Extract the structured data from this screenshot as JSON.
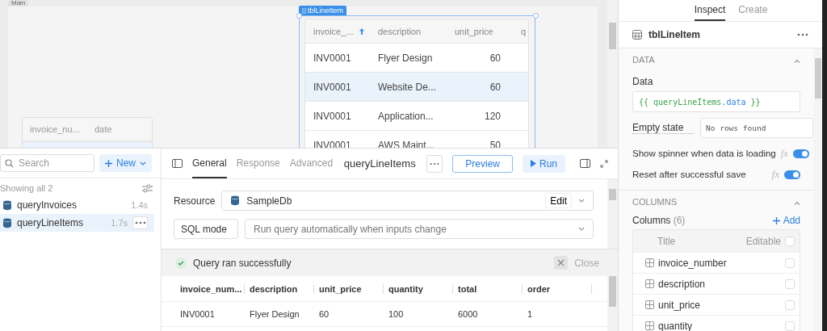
{
  "canvas": {
    "frame_label": "Main",
    "line_item_table": {
      "tag": "tblLineItem",
      "selected": true,
      "columns": [
        {
          "label": "invoice_...",
          "sorted": true
        },
        {
          "label": "description",
          "sorted": false
        },
        {
          "label": "unit_price",
          "sorted": false
        },
        {
          "label": "q",
          "sorted": false
        }
      ],
      "rows": [
        {
          "cells": [
            "INV0001",
            "Flyer Design",
            "60"
          ],
          "selected": false
        },
        {
          "cells": [
            "INV0001",
            "Website De...",
            "60"
          ],
          "selected": true
        },
        {
          "cells": [
            "INV0001",
            "Application...",
            "120"
          ],
          "selected": false
        },
        {
          "cells": [
            "INV0001",
            "AWS Maint...",
            "50"
          ],
          "selected": false
        }
      ]
    },
    "invoice_table": {
      "columns": [
        "invoice_nu...",
        "date"
      ]
    }
  },
  "queries": {
    "search": {
      "placeholder": "Search"
    },
    "new_button": "New",
    "showing": "Showing all 2",
    "items": [
      {
        "name": "queryInvoices",
        "time": "1.4s",
        "selected": false
      },
      {
        "name": "queryLineItems",
        "time": "1.7s",
        "selected": true
      }
    ]
  },
  "editor": {
    "tabs": [
      {
        "label": "General",
        "selected": true
      },
      {
        "label": "Response",
        "selected": false
      },
      {
        "label": "Advanced",
        "selected": false
      }
    ],
    "title": "queryLineItems",
    "preview": "Preview",
    "run": "Run",
    "resource": {
      "label": "Resource",
      "value": "SampleDb",
      "edit": "Edit"
    },
    "mode": "SQL mode",
    "trigger": "Run query automatically when inputs change",
    "status": {
      "message": "Query ran successfully",
      "close": "Close"
    },
    "results": {
      "columns": [
        "invoice_num...",
        "description",
        "unit_price",
        "quantity",
        "total",
        "order"
      ],
      "rows": [
        [
          "INV0001",
          "Flyer Design",
          "60",
          "100",
          "6000",
          "1"
        ]
      ]
    }
  },
  "inspector": {
    "tabs": [
      {
        "label": "Inspect",
        "selected": true
      },
      {
        "label": "Create",
        "selected": false
      }
    ],
    "component": "tblLineItem",
    "data_section": {
      "title": "DATA",
      "expanded": true,
      "data_label": "Data",
      "data_tokens": [
        {
          "text": "{{ queryLineItems",
          "kind": "template"
        },
        {
          "text": ".data",
          "kind": "property"
        },
        {
          "text": " }}",
          "kind": "template"
        }
      ],
      "empty_label": "Empty state",
      "empty_value": "No rows found",
      "toggles": [
        {
          "label": "Show spinner when data is loading",
          "fx": "fx",
          "on": true
        },
        {
          "label": "Reset after successful save",
          "fx": "fx",
          "on": true
        }
      ]
    },
    "columns_section": {
      "title": "COLUMNS",
      "expanded": true,
      "label": "Columns",
      "count": "(6)",
      "add": "Add",
      "header": {
        "title": "Title",
        "editable": "Editable",
        "all_editable": false
      },
      "items": [
        {
          "name": "invoice_number",
          "editable": false
        },
        {
          "name": "description",
          "editable": false
        },
        {
          "name": "unit_price",
          "editable": false
        },
        {
          "name": "quantity",
          "editable": false
        }
      ]
    }
  }
}
